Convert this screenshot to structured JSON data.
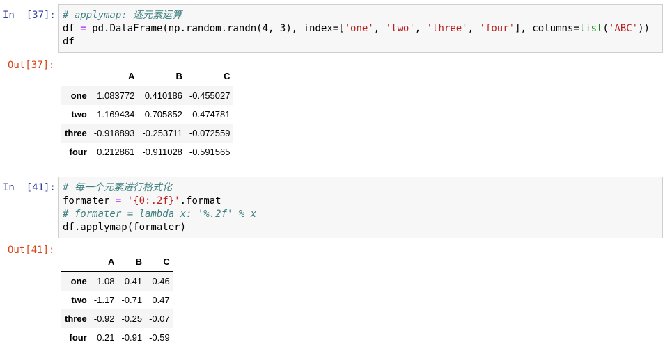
{
  "cells": [
    {
      "in_prompt": "In  [37]:",
      "code": {
        "comment": "# applymap: 逐元素运算",
        "line2": {
          "df": "df",
          "eq": "=",
          "ctor": "pd.DataFrame(np.random.randn(4, 3), index=[",
          "s1": "'one'",
          "c1": ", ",
          "s2": "'two'",
          "c2": ", ",
          "s3": "'three'",
          "c3": ", ",
          "s4": "'four'",
          "c4": "], columns=",
          "kw": "list",
          "paren": "(",
          "s5": "'ABC'",
          "close": "))"
        },
        "line3": "df"
      },
      "out_prompt": "Out[37]:",
      "table": {
        "columns": [
          "",
          "A",
          "B",
          "C"
        ],
        "rows": [
          [
            "one",
            "1.083772",
            "0.410186",
            "-0.455027"
          ],
          [
            "two",
            "-1.169434",
            "-0.705852",
            "0.474781"
          ],
          [
            "three",
            "-0.918893",
            "-0.253711",
            "-0.072559"
          ],
          [
            "four",
            "0.212861",
            "-0.911028",
            "-0.591565"
          ]
        ]
      }
    },
    {
      "in_prompt": "In  [41]:",
      "code": {
        "comment1": "# 每一个元素进行格式化",
        "line2": {
          "var": "formater",
          "eq": "=",
          "str": "'{0:.2f}'",
          "rest": ".format"
        },
        "comment2": "# formater = lambda x: '%.2f' % x",
        "line4": "df.applymap(formater)"
      },
      "out_prompt": "Out[41]:",
      "table": {
        "columns": [
          "",
          "A",
          "B",
          "C"
        ],
        "rows": [
          [
            "one",
            "1.08",
            "0.41",
            "-0.46"
          ],
          [
            "two",
            "-1.17",
            "-0.71",
            "0.47"
          ],
          [
            "three",
            "-0.92",
            "-0.25",
            "-0.07"
          ],
          [
            "four",
            "0.21",
            "-0.91",
            "-0.59"
          ]
        ]
      }
    }
  ]
}
